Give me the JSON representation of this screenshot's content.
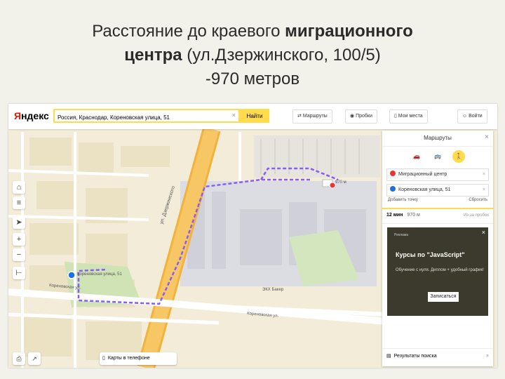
{
  "slide": {
    "title_line1_normal": "Расстояние до краевого ",
    "title_line1_bold": "миграционного",
    "title_line2_bold": "центра",
    "title_line2_normal": " (ул.Дзержинского, 100/5)",
    "title_line3": "-970 метров"
  },
  "app": {
    "logo_first": "Я",
    "logo_rest": "ндекс",
    "search_value": "Россия, Краснодар, Кореновская улица, 51",
    "search_clear": "×",
    "find_label": "Найти",
    "route_label": "Маршруты",
    "traffic_label": "Пробки",
    "my_places_label": "Мои места",
    "login_label": "Войти"
  },
  "route_panel": {
    "title": "Маршруты",
    "close": "×",
    "modes": [
      "🚗",
      "🚌",
      "🚶"
    ],
    "point_a": "Миграционный центр",
    "point_b": "Кореновская улица, 51",
    "point_clear": "×",
    "add_point": "Добавить точку",
    "reset": "Сбросить",
    "result_time": "12 мин",
    "result_dist": "970 м",
    "result_misc": "Из-за пробок",
    "ad_tag": "Реклама",
    "ad_title": "Курсы по \"JavaScript\"",
    "ad_subtitle": "Обучение с нуля. Диплом + удобный график!",
    "ad_button": "Записаться",
    "ad_close": "×",
    "results_label": "Результаты поиска",
    "results_close": "×"
  },
  "map_labels": {
    "street_dzerzhinskogo": "ул. Дзержинского",
    "street_korenovskaya": "Кореновская ул.",
    "street_korenovskaya2": "Кореновская ул.",
    "marker_b": "Кореновская улица, 51",
    "marker_a_dist": "970 м",
    "mechanic": "ЭКХ Бакер",
    "phone_label": "Карты в телефоне"
  },
  "colors": {
    "accent": "#ffdb4d",
    "route": "#8a5cf6",
    "road_major": "#f5b74a",
    "block": "#ebe4cc",
    "industrial": "#dcdde3"
  }
}
